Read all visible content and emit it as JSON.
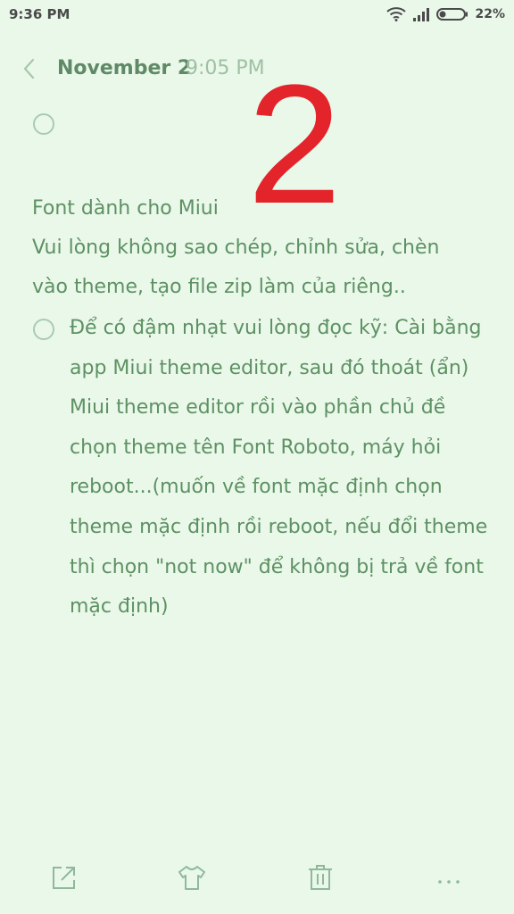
{
  "status_bar": {
    "time": "9:36 PM",
    "battery": "22%",
    "icons": [
      "wifi-icon",
      "signal-icon",
      "battery-icon"
    ]
  },
  "header": {
    "back_icon": "chevron-left-icon",
    "date": "November 2",
    "time": "9:05 PM"
  },
  "overlay": {
    "number": "2",
    "color": "#e3242b"
  },
  "note": {
    "lines": [
      "Font dành cho Miui",
      "Vui lòng không sao chép, chỉnh sửa, chèn",
      "vào theme, tạo file zip làm của riêng.."
    ],
    "task_item": {
      "checked": false,
      "text": "Để có đậm nhạt vui lòng đọc kỹ: Cài bằng app Miui theme editor, sau đó thoát (ẩn) Miui theme editor rồi vào phần chủ đề chọn theme tên Font Roboto, máy hỏi reboot...(muốn về font mặc định chọn theme mặc định rồi reboot, nếu đổi theme thì chọn \"not now\" để không bị trả về font mặc định)"
    }
  },
  "toolbar": {
    "icons": [
      "share-icon",
      "theme-shirt-icon",
      "delete-icon",
      "more-icon"
    ]
  },
  "colors": {
    "background": "#eaf8ea",
    "text": "#5d9163",
    "accent": "#e3242b"
  }
}
